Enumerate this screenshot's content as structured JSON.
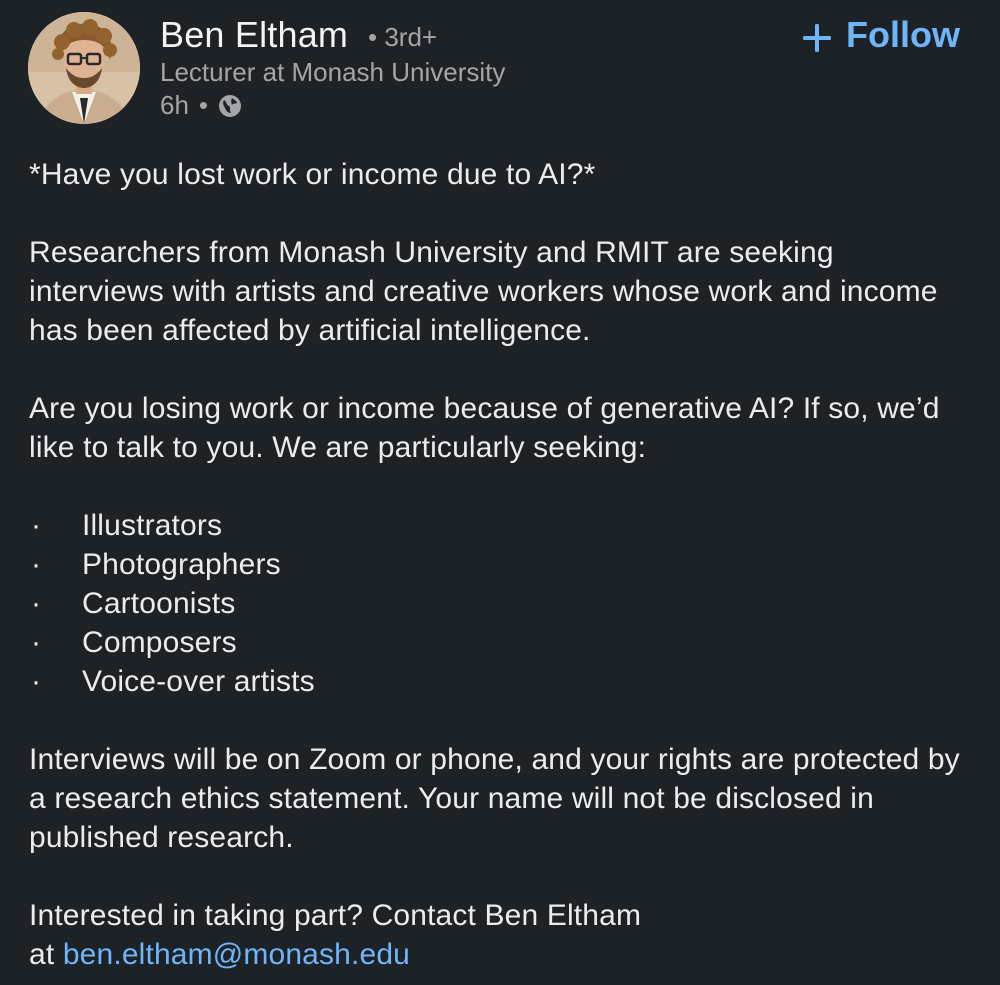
{
  "author": {
    "name": "Ben Eltham",
    "degree": "3rd+",
    "degree_separator": "•",
    "headline": "Lecturer at Monash University",
    "time": "6h",
    "meta_separator": "•",
    "visibility_icon": "globe-icon",
    "avatar_icon": "profile-photo"
  },
  "follow": {
    "icon": "plus-icon",
    "label": "Follow",
    "color": "#70b5f9"
  },
  "post": {
    "title_line": "*Have you lost work or income due to AI?*",
    "paragraph1": "Researchers from Monash University and RMIT are seeking interviews with artists and creative workers whose work and income has been affected by artificial intelligence.",
    "paragraph2": "Are you losing work or income because of generative AI? If so, we’d like to talk to you. We are particularly seeking:",
    "bullet_mark": "·",
    "bullets": [
      "Illustrators",
      "Photographers",
      "Cartoonists",
      "Composers",
      "Voice-over artists"
    ],
    "paragraph3": "Interviews will be on Zoom or phone, and your rights are protected by a research ethics statement. Your name will not be disclosed in published research.",
    "contact_line1": "Interested in taking part? Contact Ben Eltham",
    "contact_prefix": "at",
    "contact_email": "ben.eltham@monash.edu"
  },
  "colors": {
    "background": "#1d2226",
    "text": "#ececec",
    "secondary_text": "#a3a6a9",
    "link": "#70b5f9"
  }
}
